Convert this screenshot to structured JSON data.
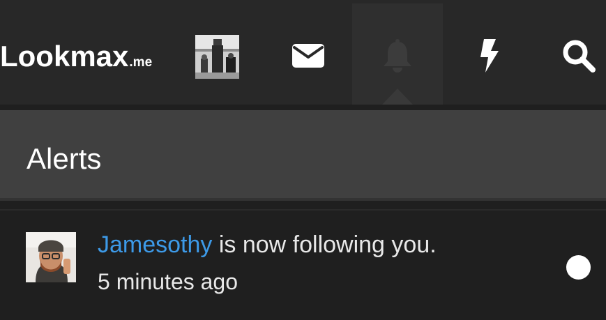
{
  "header": {
    "logo_main": "Lookmax",
    "logo_sub": ".me",
    "nav_icons": [
      "envelope-icon",
      "bell-icon",
      "bolt-icon",
      "search-icon"
    ]
  },
  "alerts": {
    "title": "Alerts",
    "items": [
      {
        "user": "Jamesothy",
        "message": " is now following you.",
        "time": "5 minutes ago",
        "unread": true
      }
    ]
  },
  "colors": {
    "accent": "#3d9ae8",
    "topbar": "#282828",
    "header": "#404040",
    "background": "#1f1f1f"
  }
}
